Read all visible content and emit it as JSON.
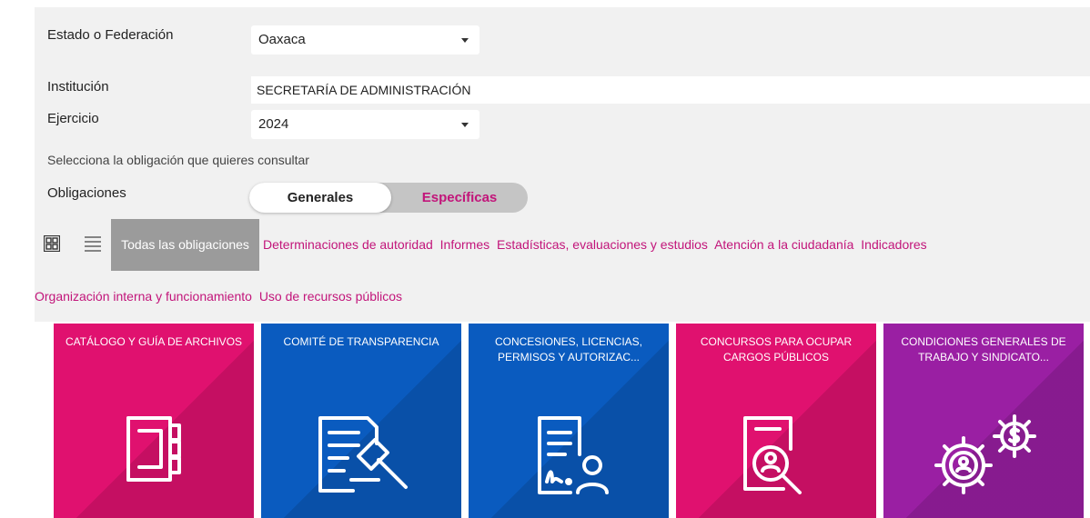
{
  "filters": {
    "estado_label": "Estado o Federación",
    "estado_value": "Oaxaca",
    "institucion_label": "Institución",
    "institucion_value": "SECRETARÍA DE ADMINISTRACIÓN",
    "ejercicio_label": "Ejercicio",
    "ejercicio_value": "2024",
    "hint": "Selecciona la obligación que quieres consultar",
    "obligaciones_label": "Obligaciones",
    "toggle": {
      "generales": "Generales",
      "especificas": "Específicas",
      "selected": "Generales"
    }
  },
  "categories": {
    "active": "Todas las obligaciones",
    "row1": [
      "Determinaciones de autoridad",
      "Informes",
      "Estadísticas, evaluaciones y estudios",
      "Atención a la ciudadanía",
      "Indicadores"
    ],
    "row2": [
      "Organización interna y funcionamiento",
      "Uso de recursos públicos"
    ]
  },
  "cards": [
    {
      "title": "CATÁLOGO Y GUÍA DE ARCHIVOS",
      "color": "#e0116f",
      "icon": "binder-icon"
    },
    {
      "title": "COMITÉ DE TRANSPARENCIA",
      "color": "#0a5bbf",
      "icon": "document-gavel-icon"
    },
    {
      "title": "CONCESIONES, LICENCIAS, PERMISOS Y AUTORIZAC...",
      "color": "#0a5bbf",
      "icon": "document-signature-user-icon"
    },
    {
      "title": "CONCURSOS PARA OCUPAR CARGOS PÚBLICOS",
      "color": "#e0116f",
      "icon": "document-search-user-icon"
    },
    {
      "title": "CONDICIONES GENERALES DE TRABAJO Y SINDICATO...",
      "color": "#9a1fa3",
      "icon": "gears-money-icon"
    }
  ],
  "colors": {
    "accent": "#c2157a",
    "panel": "#f1f1f1",
    "active_tab": "#9b9b9b"
  }
}
